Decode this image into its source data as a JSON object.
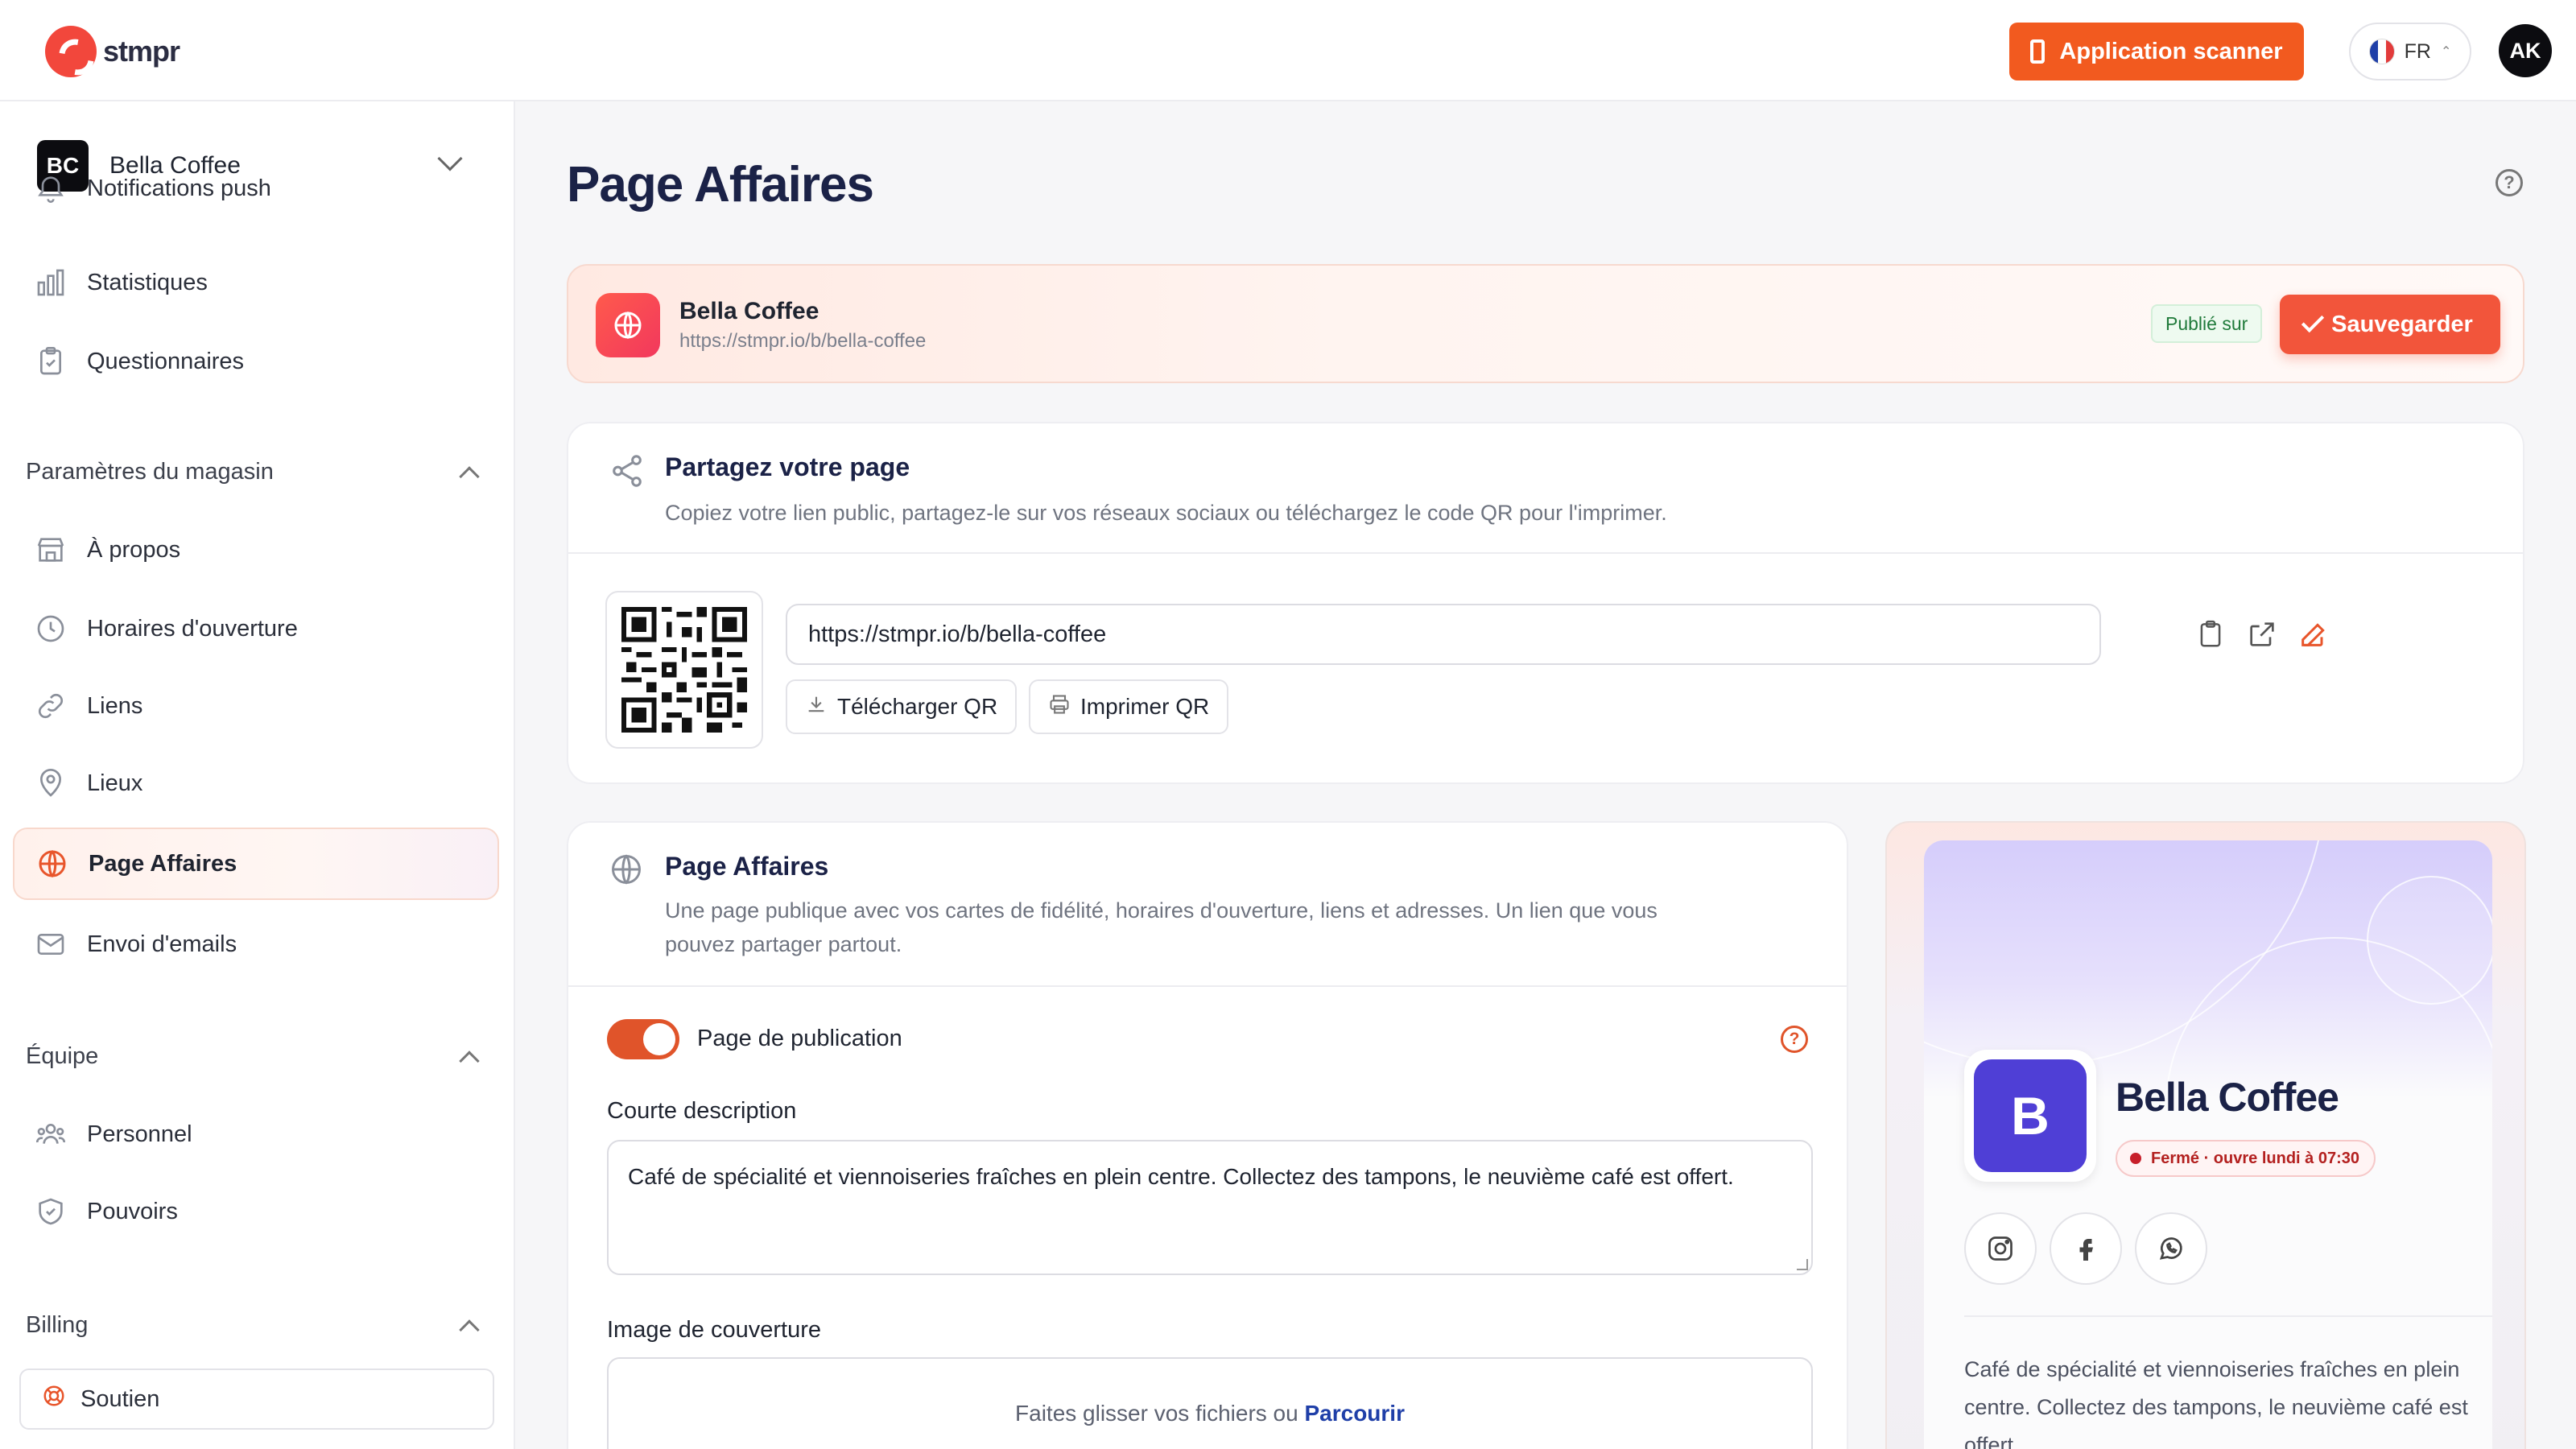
{
  "topbar": {
    "logo_text": "stmpr",
    "scanner_button": "Application scanner",
    "lang": "FR",
    "user_initials": "AK"
  },
  "sidebar": {
    "store": {
      "initials": "BC",
      "name": "Bella Coffee"
    },
    "items_top": [
      {
        "label": "Notifications push",
        "icon": "bell-icon"
      },
      {
        "label": "Statistiques",
        "icon": "bar-chart-icon"
      },
      {
        "label": "Questionnaires",
        "icon": "clipboard-icon"
      }
    ],
    "section_store": "Paramètres du magasin",
    "items_store": [
      {
        "label": "À propos",
        "icon": "store-icon"
      },
      {
        "label": "Horaires d'ouverture",
        "icon": "clock-icon"
      },
      {
        "label": "Liens",
        "icon": "link-icon"
      },
      {
        "label": "Lieux",
        "icon": "map-pin-icon"
      },
      {
        "label": "Page Affaires",
        "icon": "globe-icon",
        "active": true
      },
      {
        "label": "Envoi d'emails",
        "icon": "mail-icon"
      }
    ],
    "section_team": "Équipe",
    "items_team": [
      {
        "label": "Personnel",
        "icon": "users-icon"
      },
      {
        "label": "Pouvoirs",
        "icon": "shield-check-icon"
      }
    ],
    "section_billing": "Billing",
    "support_label": "Soutien"
  },
  "main": {
    "title": "Page Affaires",
    "banner": {
      "name": "Bella Coffee",
      "url": "https://stmpr.io/b/bella-coffee",
      "badge": "Publié sur",
      "save": "Sauvegarder"
    },
    "share": {
      "title": "Partagez votre page",
      "subtitle": "Copiez votre lien public, partagez-le sur vos réseaux sociaux ou téléchargez le code QR pour l'imprimer.",
      "url": "https://stmpr.io/b/bella-coffee",
      "download_qr": "Télécharger QR",
      "print_qr": "Imprimer QR"
    },
    "page": {
      "title": "Page Affaires",
      "subtitle_1": "Une page publique avec vos cartes de fidélité, horaires d'ouverture, liens et adresses. Un lien que vous",
      "subtitle_2": "pouvez partager partout.",
      "toggle_label": "Page de publication",
      "toggle_on": true,
      "desc_label": "Courte description",
      "desc_value": "Café de spécialité et viennoiseries fraîches en plein centre. Collectez des tampons, le neuvième café est offert.",
      "cover_label": "Image de couverture",
      "drop_text": "Faites glisser vos fichiers ou",
      "browse": "Parcourir"
    },
    "preview": {
      "avatar_letter": "B",
      "name": "Bella Coffee",
      "status": "Fermé · ouvre lundi à 07:30",
      "socials": [
        "instagram-icon",
        "facebook-icon",
        "whatsapp-icon"
      ],
      "description": "Café de spécialité et viennoiseries fraîches en plein centre. Collectez des tampons, le neuvième café est offert."
    }
  },
  "colors": {
    "accent": "#f25a1f",
    "primary_text": "#1b2247",
    "status_red": "#c71f2a",
    "preview_avatar": "#4f3fd6"
  }
}
